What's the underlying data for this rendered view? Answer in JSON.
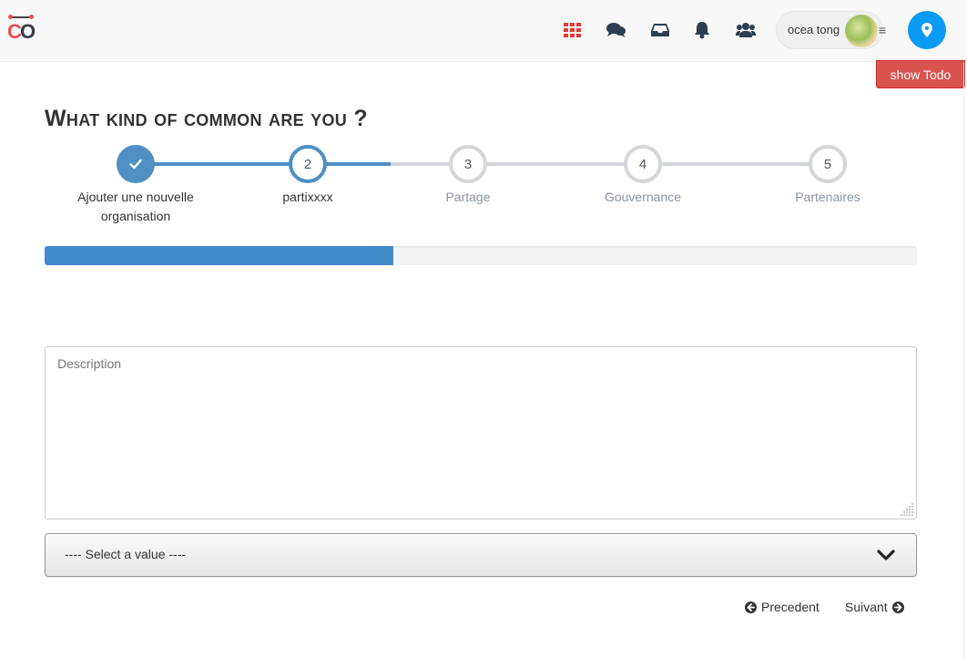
{
  "header": {
    "user_name": "ocea tong",
    "menu_glyph": "≡",
    "icons": [
      "apps-grid-icon",
      "chat-icon",
      "inbox-icon",
      "bell-icon",
      "users-icon",
      "map-marker-icon"
    ],
    "accent": "#0a9bf5",
    "apps_color": "#e53935"
  },
  "todo": {
    "label": "show Todo"
  },
  "page": {
    "title": "What kind of common are you ?"
  },
  "steps": [
    {
      "number": "",
      "label": "Ajouter une nouvelle organisation",
      "state": "done"
    },
    {
      "number": "2",
      "label": "partixxxx",
      "state": "current"
    },
    {
      "number": "3",
      "label": "Partage",
      "state": "todo"
    },
    {
      "number": "4",
      "label": "Gouvernance",
      "state": "todo"
    },
    {
      "number": "5",
      "label": "Partenaires",
      "state": "todo"
    }
  ],
  "progress": {
    "percent": 40
  },
  "form": {
    "description_placeholder": "Description",
    "select_value": "---- Select a value ----"
  },
  "nav": {
    "previous": "Precedent",
    "next": "Suivant"
  },
  "colors": {
    "step_active": "#4f8fc3",
    "step_inactive": "#d4d6da",
    "todo_button": "#d9534f"
  }
}
